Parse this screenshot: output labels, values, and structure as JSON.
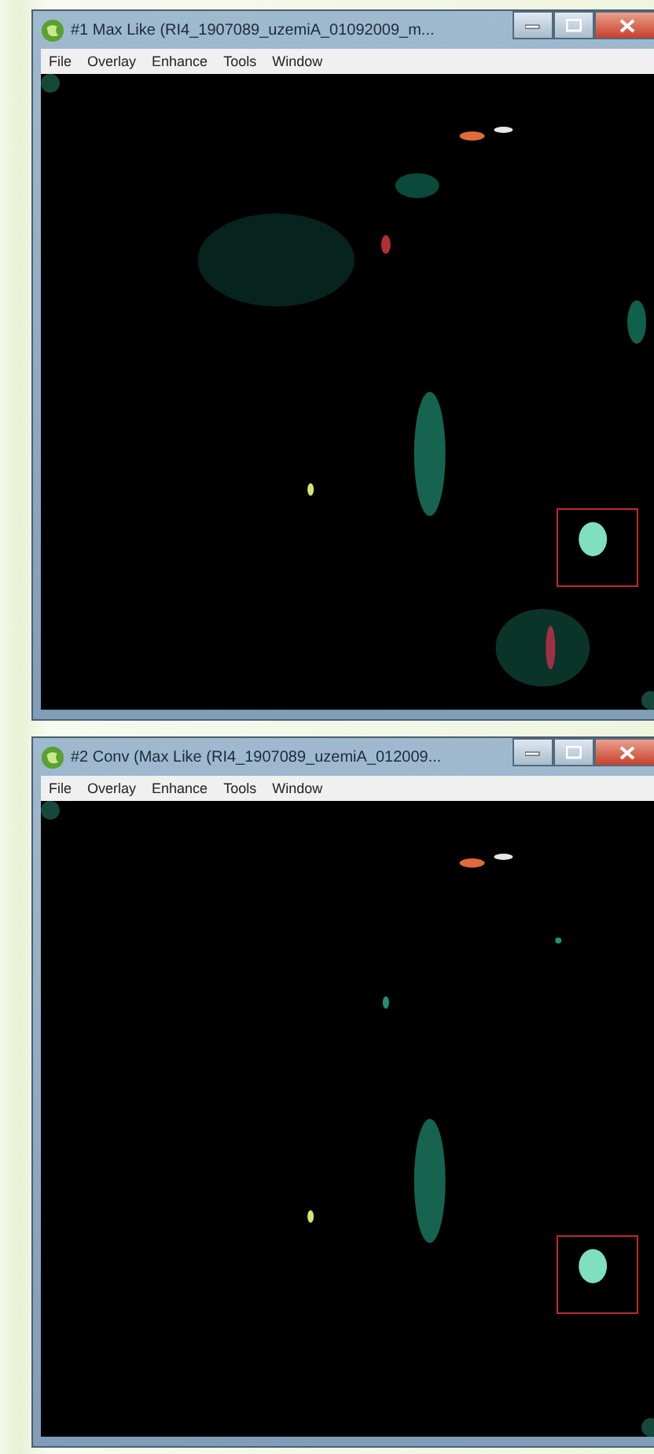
{
  "windows": [
    {
      "title": "#1 Max Like (RI4_1907089_uzemiA_01092009_m...",
      "menu": [
        "File",
        "Overlay",
        "Enhance",
        "Tools",
        "Window"
      ]
    },
    {
      "title": "#2 Conv (Max Like (RI4_1907089_uzemiA_012009...",
      "menu": [
        "File",
        "Overlay",
        "Enhance",
        "Tools",
        "Window"
      ]
    }
  ]
}
